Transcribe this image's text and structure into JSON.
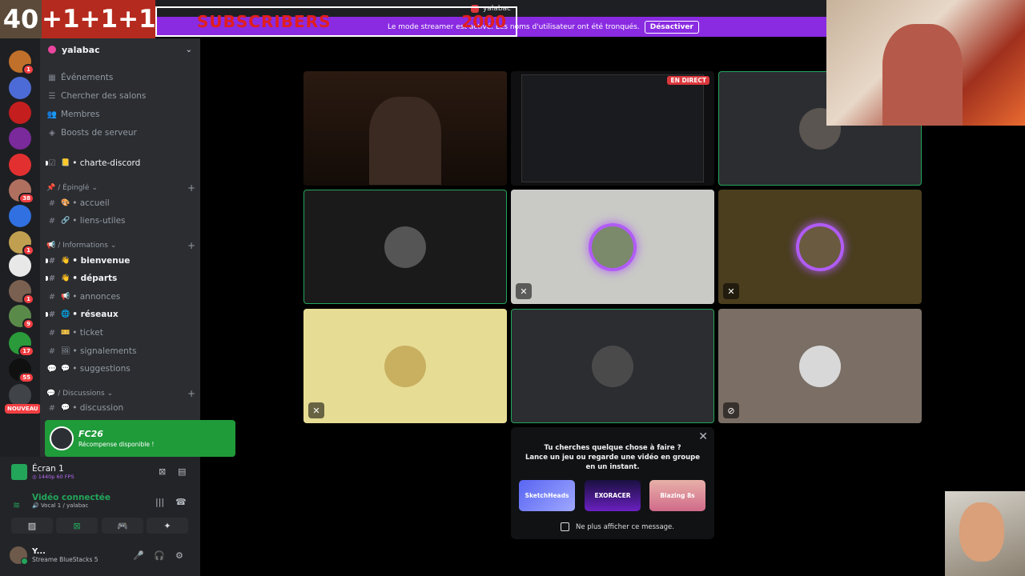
{
  "overlay": {
    "count": "40",
    "plus": [
      "+1",
      "+1",
      "+1"
    ],
    "subscribers_label": "SUBSCRIBERS",
    "subscribers_goal": "2000"
  },
  "topbar": {
    "username": "yalabac"
  },
  "banner": {
    "text": "Le mode streamer est activé. Les noms d'utilisateur ont été tronqués.",
    "button": "Désactiver"
  },
  "servers": [
    {
      "badge": "1",
      "color": "#c0702a"
    },
    {
      "badge": "",
      "color": "#4d6bd6"
    },
    {
      "badge": "",
      "color": "#c41e1e"
    },
    {
      "badge": "",
      "color": "#7a2a9a"
    },
    {
      "badge": "",
      "color": "#e23030"
    },
    {
      "badge": "38",
      "color": "#b07060"
    },
    {
      "badge": "",
      "color": "#3070e0"
    },
    {
      "badge": "1",
      "color": "#c0a050"
    },
    {
      "badge": "",
      "color": "#e8e8e8"
    },
    {
      "badge": "1",
      "color": "#7a6050"
    },
    {
      "badge": "9",
      "color": "#5a8a4a"
    },
    {
      "badge": "17",
      "color": "#2a9a3a"
    },
    {
      "badge": "55",
      "color": "#101010"
    },
    {
      "badge": "",
      "color": "#404448"
    }
  ],
  "nouveau": "NOUVEAU",
  "server": {
    "name": "yalabac"
  },
  "menu": [
    "Événements",
    "Chercher des salons",
    "Membres",
    "Boosts de serveur"
  ],
  "channels": {
    "pinned_top": {
      "name": "• charte-discord",
      "emoji": "📒"
    },
    "cat1": "/ Épinglé",
    "cat1_items": [
      {
        "name": "• accueil",
        "emoji": "🎨"
      },
      {
        "name": "• liens-utiles",
        "emoji": "🔗"
      }
    ],
    "cat2": "/ Informations",
    "cat2_items": [
      {
        "name": "• bienvenue",
        "emoji": "👋",
        "bold": true
      },
      {
        "name": "• départs",
        "emoji": "👋",
        "bold": true
      },
      {
        "name": "• annonces",
        "emoji": "📢",
        "bold": false
      },
      {
        "name": "• réseaux",
        "emoji": "🌐",
        "bold": true
      },
      {
        "name": "• ticket",
        "emoji": "🎫",
        "bold": false
      },
      {
        "name": "• signalements",
        "emoji": "🖼",
        "bold": false
      },
      {
        "name": "• suggestions",
        "emoji": "💬",
        "bold": false
      }
    ],
    "cat3": "/ Discussions",
    "cat3_items": [
      {
        "name": "• discussion",
        "emoji": "💬"
      }
    ]
  },
  "promo": {
    "title": "FC26",
    "subtitle": "Récompense disponible !"
  },
  "screen": {
    "title": "Écran 1",
    "quality": "◎ 1440p 60 FPS"
  },
  "voice": {
    "title": "Vidéo connectée",
    "subtitle": "🔊 Vocal 1 / yalabac"
  },
  "user": {
    "name": "Y...",
    "status": "Streame BlueStacks 5"
  },
  "grid": {
    "live_badge": "EN DIRECT"
  },
  "popup": {
    "line1": "Tu cherches quelque chose à faire ?",
    "line2": "Lance un jeu ou regarde une vidéo en groupe en un instant.",
    "games": [
      "SketchHeads",
      "EXORACER",
      "Blazing 8s"
    ],
    "checkbox": "Ne plus afficher ce message."
  }
}
